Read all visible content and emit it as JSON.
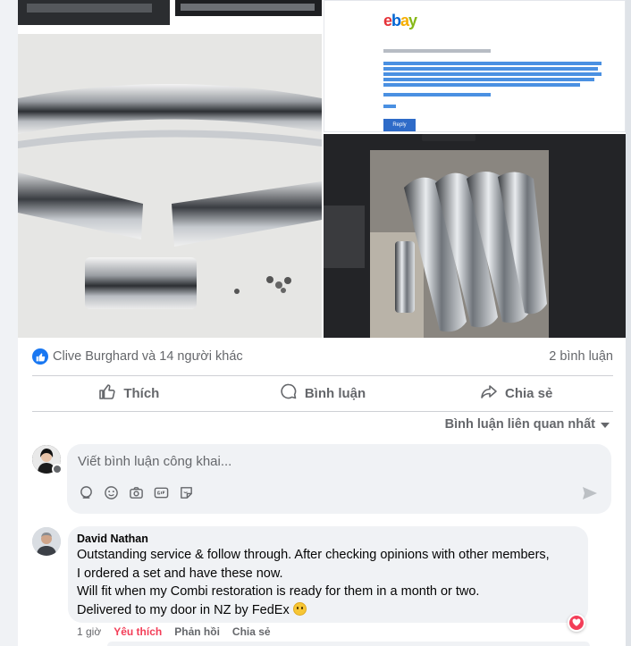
{
  "photos": {
    "ebay_logo_letters": [
      {
        "ch": "e",
        "color": "#e53238"
      },
      {
        "ch": "b",
        "color": "#0064d2"
      },
      {
        "ch": "a",
        "color": "#f5af02"
      },
      {
        "ch": "y",
        "color": "#86b817"
      }
    ],
    "ebay_reply_label": "Reply"
  },
  "reactions": {
    "summary": "Clive Burghard và 14 người khác",
    "comment_count": "2 bình luận"
  },
  "actions": {
    "like": "Thích",
    "comment": "Bình luận",
    "share": "Chia sẻ"
  },
  "sort": {
    "label": "Bình luận liên quan nhất"
  },
  "composer": {
    "placeholder": "Viết bình luận công khai..."
  },
  "comments": [
    {
      "author": "David Nathan",
      "lines": [
        "Outstanding service & follow through. After checking opinions with other members,",
        "I ordered a set and have these now.",
        "Will fit when my Combi restoration is ready for them in a month or two.",
        "Delivered to my door in NZ by FedEx"
      ],
      "time": "1 giờ",
      "like_label": "Yêu thích",
      "reply_label": "Phản hồi",
      "share_label": "Chia sẻ"
    }
  ],
  "colors": {
    "accent": "#1877f2",
    "love": "#f33e58",
    "muted": "#65676b"
  }
}
